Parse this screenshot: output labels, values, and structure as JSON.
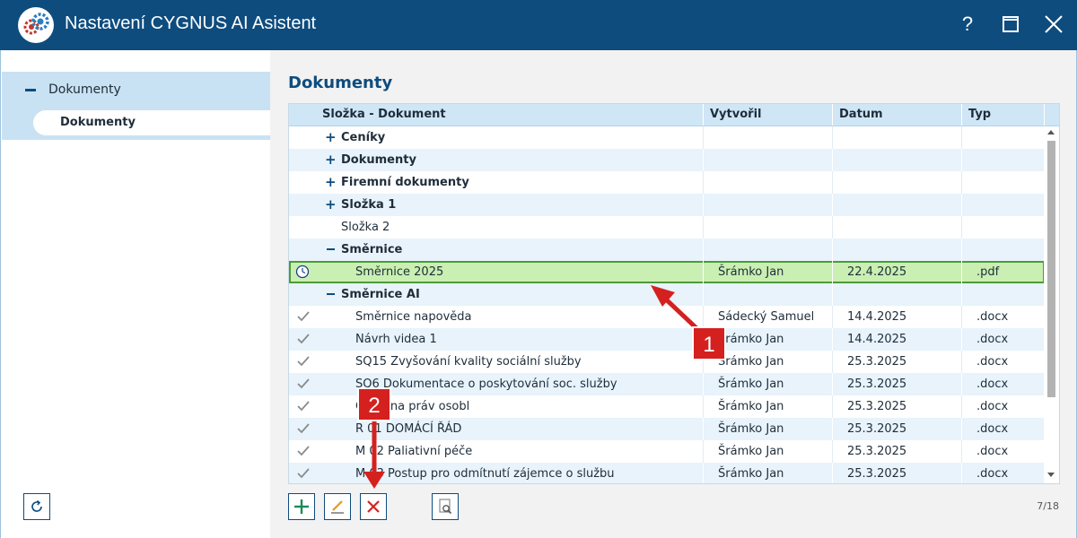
{
  "window": {
    "title": "Nastavení CYGNUS AI Asistent",
    "help_label": "?"
  },
  "sidebar": {
    "group_label": "Dokumenty",
    "item_label": "Dokumenty"
  },
  "main": {
    "title": "Dokumenty",
    "columns": [
      "Složka - Dokument",
      "Vytvořil",
      "Datum",
      "Typ"
    ],
    "rows": [
      {
        "kind": "folder-collapsed",
        "name": "Ceníky",
        "author": "",
        "date": "",
        "type": ""
      },
      {
        "kind": "folder-collapsed",
        "name": "Dokumenty",
        "author": "",
        "date": "",
        "type": ""
      },
      {
        "kind": "folder-collapsed",
        "name": "Firemní dokumenty",
        "author": "",
        "date": "",
        "type": ""
      },
      {
        "kind": "folder-collapsed",
        "name": "Složka 1",
        "author": "",
        "date": "",
        "type": ""
      },
      {
        "kind": "folder-empty",
        "name": "Složka 2",
        "author": "",
        "date": "",
        "type": ""
      },
      {
        "kind": "folder-expanded",
        "name": "Směrnice",
        "author": "",
        "date": "",
        "type": ""
      },
      {
        "kind": "doc-pending",
        "name": "Směrnice 2025",
        "author": "Šrámko Jan",
        "date": "22.4.2025",
        "type": ".pdf",
        "selected": true
      },
      {
        "kind": "folder-expanded",
        "name": "Směrnice AI",
        "author": "",
        "date": "",
        "type": ""
      },
      {
        "kind": "doc-done",
        "name": "Směrnice napověda",
        "author": "Sádecký Samuel",
        "date": "14.4.2025",
        "type": ".docx"
      },
      {
        "kind": "doc-done",
        "name": "Návrh videa 1",
        "author": "Šrámko Jan",
        "date": "14.4.2025",
        "type": ".docx"
      },
      {
        "kind": "doc-done",
        "name": "SQ15 Zvyšování kvality sociální služby",
        "author": "Šrámko Jan",
        "date": "25.3.2025",
        "type": ".docx"
      },
      {
        "kind": "doc-done",
        "name": "SQ6 Dokumentace o poskytování soc. služby",
        "author": "Šrámko Jan",
        "date": "25.3.2025",
        "type": ".docx"
      },
      {
        "kind": "doc-done",
        "name": "Ochrana práv osobl",
        "author": "Šrámko Jan",
        "date": "25.3.2025",
        "type": ".docx"
      },
      {
        "kind": "doc-done",
        "name": "R 01 DOMÁCÍ ŘÁD",
        "author": "Šrámko Jan",
        "date": "25.3.2025",
        "type": ".docx"
      },
      {
        "kind": "doc-done",
        "name": "M 02 Paliativní péče",
        "author": "Šrámko Jan",
        "date": "25.3.2025",
        "type": ".docx"
      },
      {
        "kind": "doc-done",
        "name": "M 03 Postup pro odmítnutí zájemce o službu",
        "author": "Šrámko Jan",
        "date": "25.3.2025",
        "type": ".docx"
      }
    ],
    "pager": "7/18"
  },
  "toolbar": {
    "buttons": [
      "add-icon",
      "edit-icon",
      "delete-icon",
      "preview-icon"
    ]
  },
  "callouts": [
    {
      "number": "1"
    },
    {
      "number": "2"
    }
  ],
  "colors": {
    "titlebar": "#0e4c7e",
    "accent": "#0e4c7e",
    "header_bg": "#cfe6f6",
    "selected_row": "#c9efb2",
    "callout": "#d4211f",
    "add": "#1b8a5a",
    "delete": "#d4211f"
  }
}
